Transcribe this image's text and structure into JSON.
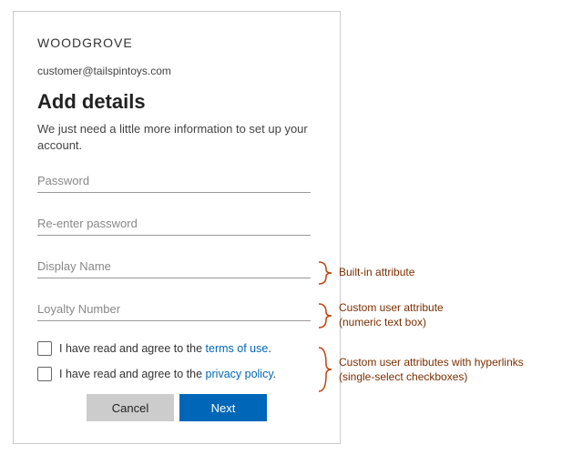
{
  "brand": "WOODGROVE",
  "email": "customer@tailspintoys.com",
  "title": "Add details",
  "subtitle": "We just need a little more information to set up your account.",
  "fields": {
    "password": {
      "placeholder": "Password"
    },
    "repassword": {
      "placeholder": "Re-enter password"
    },
    "displayName": {
      "placeholder": "Display Name"
    },
    "loyalty": {
      "placeholder": "Loyalty Number"
    }
  },
  "checks": {
    "termsPrefix": "I have read and agree to the ",
    "termsLink": "terms of use",
    "privacyPrefix": "I have read and agree to the ",
    "privacyLink": "privacy policy",
    "dot": "."
  },
  "buttons": {
    "cancel": "Cancel",
    "next": "Next"
  },
  "annotations": {
    "builtIn": "Built-in attribute",
    "customNumeric1": "Custom user attribute",
    "customNumeric2": "(numeric text box)",
    "customChecks1": "Custom user attributes with hyperlinks",
    "customChecks2": "(single-select checkboxes)"
  }
}
